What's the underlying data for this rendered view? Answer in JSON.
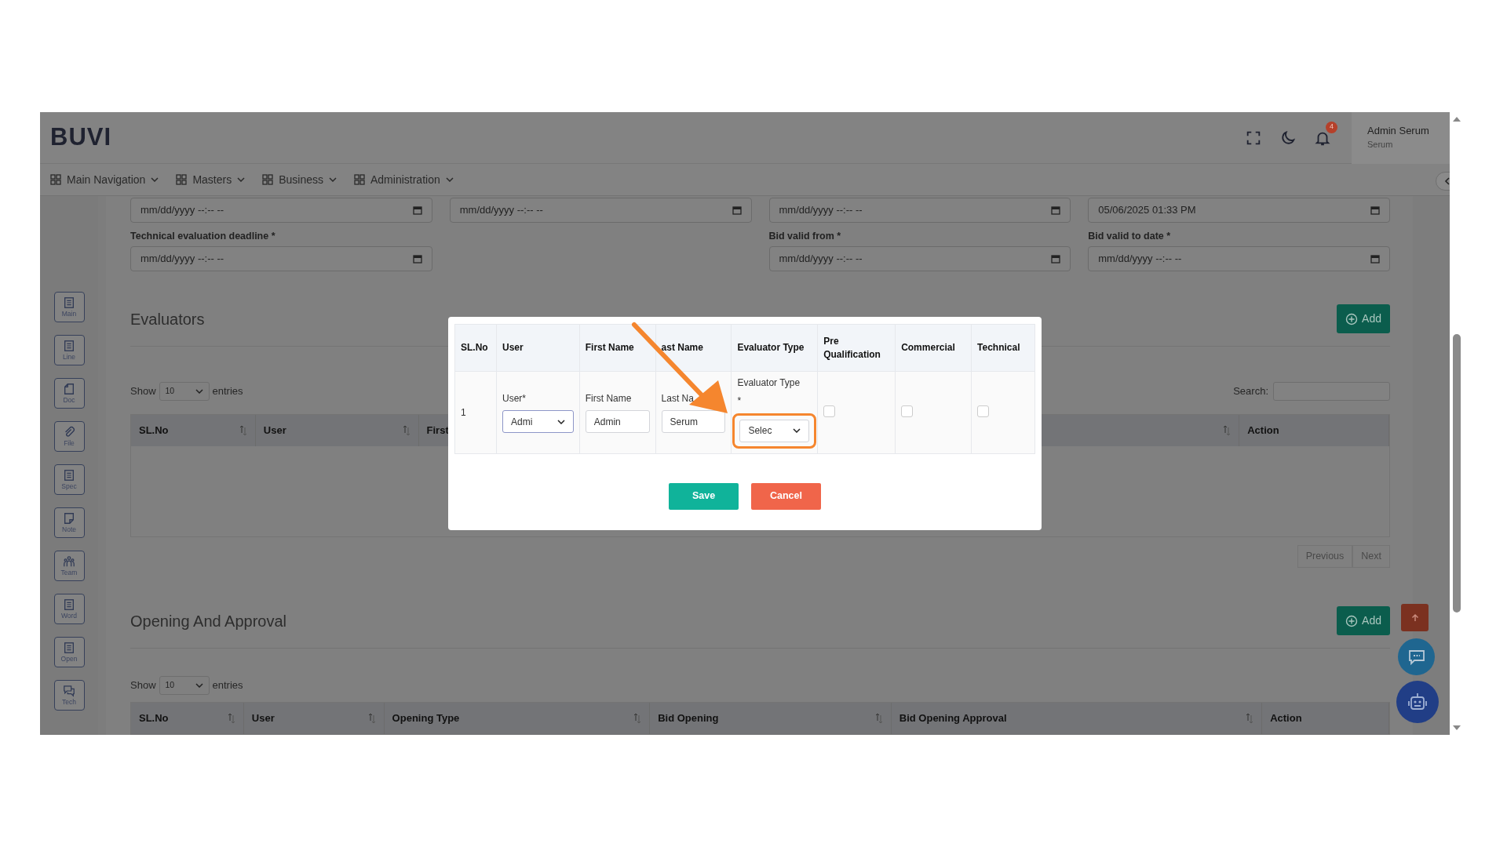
{
  "header": {
    "logo": "BUVI",
    "notification_count": "4",
    "user_name": "Admin Serum",
    "user_role": "Serum"
  },
  "nav": [
    {
      "label": "Main Navigation"
    },
    {
      "label": "Masters"
    },
    {
      "label": "Business"
    },
    {
      "label": "Administration"
    }
  ],
  "sidebar": [
    {
      "label": "Main",
      "kind": "list"
    },
    {
      "label": "Line",
      "kind": "list"
    },
    {
      "label": "Doc",
      "kind": "page"
    },
    {
      "label": "File",
      "kind": "clip"
    },
    {
      "label": "Spec",
      "kind": "list"
    },
    {
      "label": "Note",
      "kind": "note"
    },
    {
      "label": "Team",
      "kind": "team"
    },
    {
      "label": "Word",
      "kind": "list"
    },
    {
      "label": "Open",
      "kind": "list"
    },
    {
      "label": "Tech",
      "kind": "chat"
    }
  ],
  "form_rows": [
    [
      {
        "kind": "date",
        "placeholder": "mm/dd/yyyy --:-- --"
      },
      {
        "kind": "date",
        "placeholder": "mm/dd/yyyy --:-- --"
      },
      {
        "kind": "date",
        "placeholder": "mm/dd/yyyy --:-- --"
      },
      {
        "kind": "date",
        "value": "05/06/2025 01:33 PM"
      }
    ],
    [
      {
        "kind": "date",
        "label": "Technical evaluation deadline *",
        "placeholder": "mm/dd/yyyy --:-- --"
      },
      {
        "kind": "blank"
      },
      {
        "kind": "date",
        "label": "Bid valid from *",
        "placeholder": "mm/dd/yyyy --:-- --"
      },
      {
        "kind": "date",
        "label": "Bid valid to date *",
        "placeholder": "mm/dd/yyyy --:-- --"
      }
    ]
  ],
  "evaluators": {
    "title": "Evaluators",
    "add_label": "Add",
    "show_label": "Show",
    "entries_value": "10",
    "entries_label": "entries",
    "search_label": "Search:",
    "columns": [
      {
        "label": "SL.No",
        "sortable": true
      },
      {
        "label": "User",
        "sortable": true
      },
      {
        "label": "First",
        "sortable": true
      },
      {
        "label": "Action",
        "sortable": false
      }
    ],
    "pagination": [
      "Previous",
      "Next"
    ]
  },
  "opening": {
    "title": "Opening And Approval",
    "add_label": "Add",
    "show_label": "Show",
    "entries_value": "10",
    "entries_label": "entries",
    "columns": [
      {
        "label": "SL.No",
        "sortable": true
      },
      {
        "label": "User",
        "sortable": true
      },
      {
        "label": "Opening Type",
        "sortable": true
      },
      {
        "label": "Bid Opening",
        "sortable": true
      },
      {
        "label": "Bid Opening Approval",
        "sortable": true
      },
      {
        "label": "Action",
        "sortable": false
      }
    ]
  },
  "modal": {
    "columns": [
      "SL.No",
      "User",
      "First Name",
      "ast Name",
      "Evaluator Type",
      "Pre Qualification",
      "Commercial",
      "Technical"
    ],
    "row": {
      "sl_no": "1",
      "cells": [
        {
          "kind": "select",
          "label": "User*",
          "value": "Admi",
          "focused": true,
          "highlighted": false
        },
        {
          "kind": "input",
          "label": "First Name",
          "value": "Admin"
        },
        {
          "kind": "input",
          "label": "Last Na",
          "value": "Serum"
        },
        {
          "kind": "select",
          "label": "Evaluator Type",
          "required_mark": "*",
          "value": "Selec",
          "focused": false,
          "highlighted": true
        },
        {
          "kind": "checkbox",
          "checked": false
        },
        {
          "kind": "checkbox",
          "checked": false
        },
        {
          "kind": "checkbox",
          "checked": false
        }
      ]
    },
    "buttons": [
      {
        "label": "Save",
        "kind": "primary"
      },
      {
        "label": "Cancel",
        "kind": "danger"
      }
    ]
  }
}
